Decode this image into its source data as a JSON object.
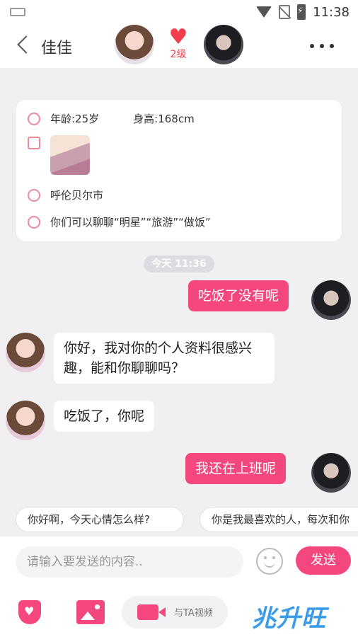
{
  "status_bar": {
    "time": "11:38"
  },
  "header": {
    "contact_name": "佳佳",
    "level": "2级"
  },
  "profile": {
    "age": "年龄:25岁",
    "height": "身高:168cm",
    "city": "呼伦贝尔市",
    "topics": "你们可以聊聊“明星”“旅游”“做饭”"
  },
  "chat": {
    "time_label": "今天 11:36",
    "messages": [
      {
        "side": "out",
        "text": "吃饭了没有呢"
      },
      {
        "side": "in",
        "text": "你好，我对你的个人资料很感兴趣，能和你聊聊吗？"
      },
      {
        "side": "in",
        "text": "吃饭了，你呢"
      },
      {
        "side": "out",
        "text": "我还在上班呢"
      }
    ]
  },
  "quick_replies": [
    "你好啊，今天心情怎么样?",
    "你是我最喜欢的人，每次和你"
  ],
  "input": {
    "placeholder": "请输入要发送的内容..",
    "send_label": "发送"
  },
  "toolbar": {
    "video_label": "与TA视频"
  },
  "watermark": "兆升旺",
  "colors": {
    "accent": "#f3477e",
    "heart": "#f23d4f"
  },
  "icons": [
    "keyboard-icon",
    "wifi-icon",
    "no-sim-icon",
    "battery-icon",
    "back-icon",
    "heart-icon",
    "more-icon",
    "person-icon",
    "image-icon",
    "location-icon",
    "topic-icon",
    "emoji-icon",
    "shield-icon",
    "video-icon"
  ]
}
